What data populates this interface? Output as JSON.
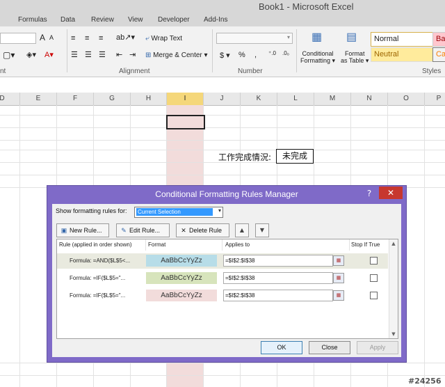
{
  "window": {
    "title": "Book1 - Microsoft Excel"
  },
  "menu": [
    "Formulas",
    "Data",
    "Review",
    "View",
    "Developer",
    "Add-Ins"
  ],
  "ribbon": {
    "groups": {
      "font": "nt",
      "alignment": "Alignment",
      "number": "Number",
      "styles": "Styles"
    },
    "wrap_text": "Wrap Text",
    "merge_center": "Merge & Center",
    "conditional_formatting": [
      "Conditional",
      "Formatting"
    ],
    "format_as_table": [
      "Format",
      "as Table"
    ],
    "styles": {
      "normal": "Normal",
      "neutral": "Neutral",
      "bad": "Bad",
      "calc": "Cal"
    },
    "currency": "$",
    "percent": "%",
    "comma": ",",
    "font_grow": "A",
    "font_shrink": "A"
  },
  "columns": [
    "D",
    "E",
    "F",
    "G",
    "H",
    "I",
    "J",
    "K",
    "L",
    "M",
    "N",
    "O",
    "P"
  ],
  "selected_column": "I",
  "sheet": {
    "status_label": "工作完成情況:",
    "status_value": "未完成"
  },
  "dialog": {
    "title": "Conditional Formatting Rules Manager",
    "help": "?",
    "close": "✕",
    "show_rules_label": "Show formatting rules for:",
    "show_rules_value": "Current Selection",
    "toolbar": {
      "new_rule": "New Rule...",
      "edit_rule": "Edit Rule...",
      "delete_rule": "Delete Rule"
    },
    "headers": {
      "rule": "Rule (applied in order shown)",
      "format": "Format",
      "applies_to": "Applies to",
      "stop_if_true": "Stop If True"
    },
    "rules": [
      {
        "rule": "Formula: =AND($L$5<...",
        "format": "AaBbCcYyZz",
        "applies_to": "=$I$2:$I$38",
        "color": "#b7dde8"
      },
      {
        "rule": "Formula: =IF($L$5=\"...",
        "format": "AaBbCcYyZz",
        "applies_to": "=$I$2:$I$38",
        "color": "#d7e4bc"
      },
      {
        "rule": "Formula: =IF($L$5=\"...",
        "format": "AaBbCcYyZz",
        "applies_to": "=$I$2:$I$38",
        "color": "#f2dcdb"
      }
    ],
    "buttons": {
      "ok": "OK",
      "close": "Close",
      "apply": "Apply"
    }
  },
  "watermark": "#24256"
}
